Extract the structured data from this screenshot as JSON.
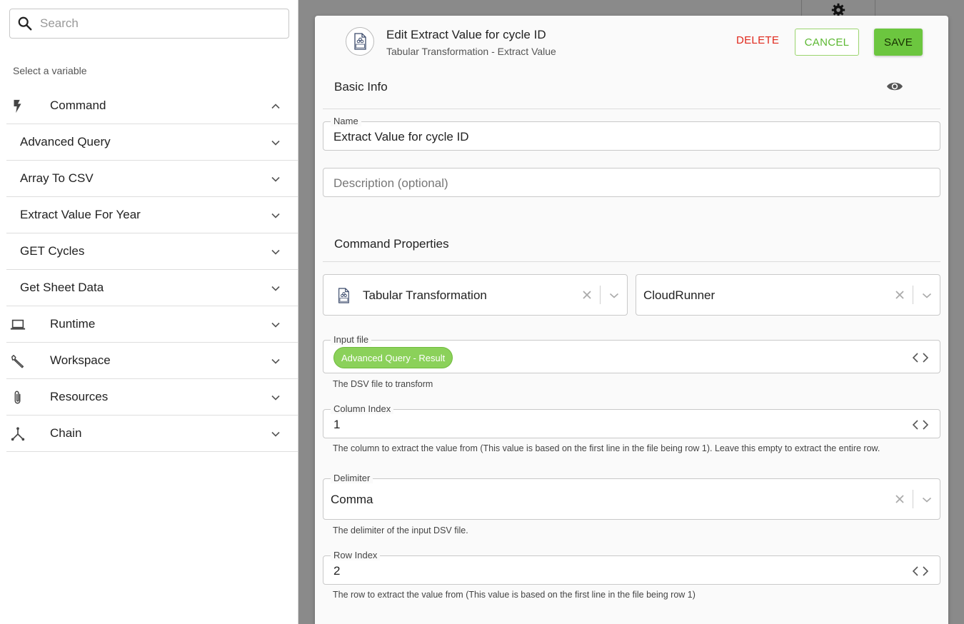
{
  "sidebar": {
    "search_placeholder": "Search",
    "select_label": "Select a variable",
    "items": [
      {
        "label": "Command",
        "type": "category",
        "icon": "bolt-icon",
        "expanded": true
      },
      {
        "label": "Advanced Query",
        "type": "sub"
      },
      {
        "label": "Array To CSV",
        "type": "sub"
      },
      {
        "label": "Extract Value For Year",
        "type": "sub"
      },
      {
        "label": "GET Cycles",
        "type": "sub"
      },
      {
        "label": "Get Sheet Data",
        "type": "sub"
      },
      {
        "label": "Runtime",
        "type": "category",
        "icon": "laptop-icon"
      },
      {
        "label": "Workspace",
        "type": "category",
        "icon": "wrench-icon"
      },
      {
        "label": "Resources",
        "type": "category",
        "icon": "paperclip-icon"
      },
      {
        "label": "Chain",
        "type": "category",
        "icon": "chain-icon"
      }
    ]
  },
  "dialog": {
    "title": "Edit Extract Value for cycle ID",
    "subtitle": "Tabular Transformation - Extract Value",
    "delete_label": "DELETE",
    "cancel_label": "CANCEL",
    "save_label": "SAVE",
    "basic_info": "Basic Info",
    "name_label": "Name",
    "name_value": "Extract Value for cycle ID",
    "description_placeholder": "Description (optional)",
    "command_properties": "Command Properties",
    "command_select": "Tabular Transformation",
    "runner_select": "CloudRunner",
    "input_file_label": "Input file",
    "input_file_chip": "Advanced Query - Result",
    "input_file_help": "The DSV file to transform",
    "column_index_label": "Column Index",
    "column_index_value": "1",
    "column_index_help": "The column to extract the value from (This value is based on the first line in the file being row 1). Leave this empty to extract the entire row.",
    "delimiter_label": "Delimiter",
    "delimiter_value": "Comma",
    "delimiter_help": "The delimiter of the input DSV file.",
    "row_index_label": "Row Index",
    "row_index_value": "2",
    "row_index_help": "The row to extract the value from (This value is based on the first line in the file being row 1)"
  },
  "colors": {
    "save_bg": "#6cc63f",
    "cancel_text": "#5cb832",
    "delete_text": "#e0281c",
    "chip_bg": "#8bd15a"
  }
}
